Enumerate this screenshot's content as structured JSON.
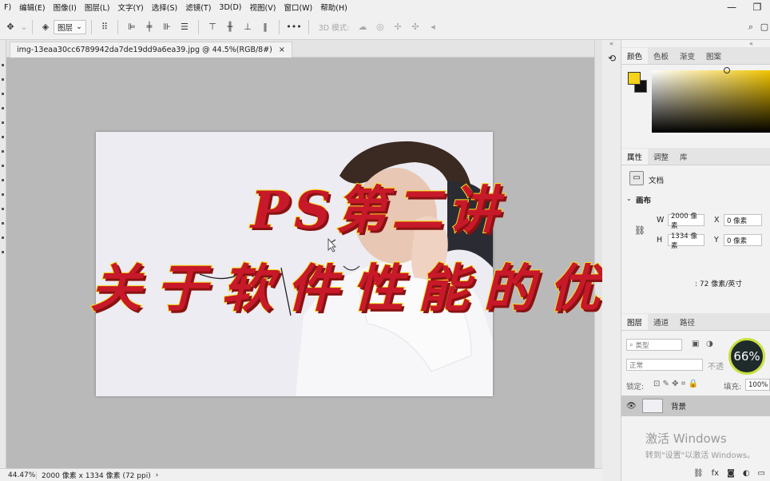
{
  "menu": [
    "F)",
    "编辑(E)",
    "图像(I)",
    "图层(L)",
    "文字(Y)",
    "选择(S)",
    "滤镜(T)",
    "3D(D)",
    "视图(V)",
    "窗口(W)",
    "帮助(H)"
  ],
  "options": {
    "layer_dropdown": "图层",
    "mode_3d": "3D 模式:",
    "more": "•••"
  },
  "document": {
    "tab_title": "img-13eaa30cc6789942da7de19dd9a6ea39.jpg @ 44.5%(RGB/8#)",
    "close": "×"
  },
  "overlay": {
    "line1": "PS第二讲",
    "line2": "关于软件性能的优化"
  },
  "status": {
    "zoom": "44.47%",
    "dims": "2000 像素 x 1334 像素 (72 ppi)",
    "arrow": "›"
  },
  "panels": {
    "color_tabs": [
      "颜色",
      "色板",
      "渐变",
      "图案"
    ],
    "props_tabs": [
      "属性",
      "调整",
      "库"
    ],
    "doc_label": "文档",
    "canvas_header": "画布",
    "w_label": "W",
    "w_value": "2000 像素",
    "h_label": "H",
    "h_value": "1334 像素",
    "x_label": "X",
    "x_value": "0 像素",
    "y_label": "Y",
    "y_value": "0 像素",
    "resolution": ": 72 像素/英寸",
    "layers_tabs": [
      "图层",
      "通道",
      "路径"
    ],
    "kind_filter": "类型",
    "blend_mode": "正常",
    "opacity_label": "不透",
    "lock_label": "锁定:",
    "fill_label": "填充:",
    "fill_value": "100%",
    "layer_name": "背景"
  },
  "overlay_badge": "66%",
  "watermark": {
    "line1": "激活 Windows",
    "line2": "转到\"设置\"以激活 Windows。"
  },
  "icons": [
    "move-tool-icon",
    "3d-icon",
    "align-icon",
    "history-icon",
    "search-icon",
    "eye-icon",
    "link-icon"
  ]
}
